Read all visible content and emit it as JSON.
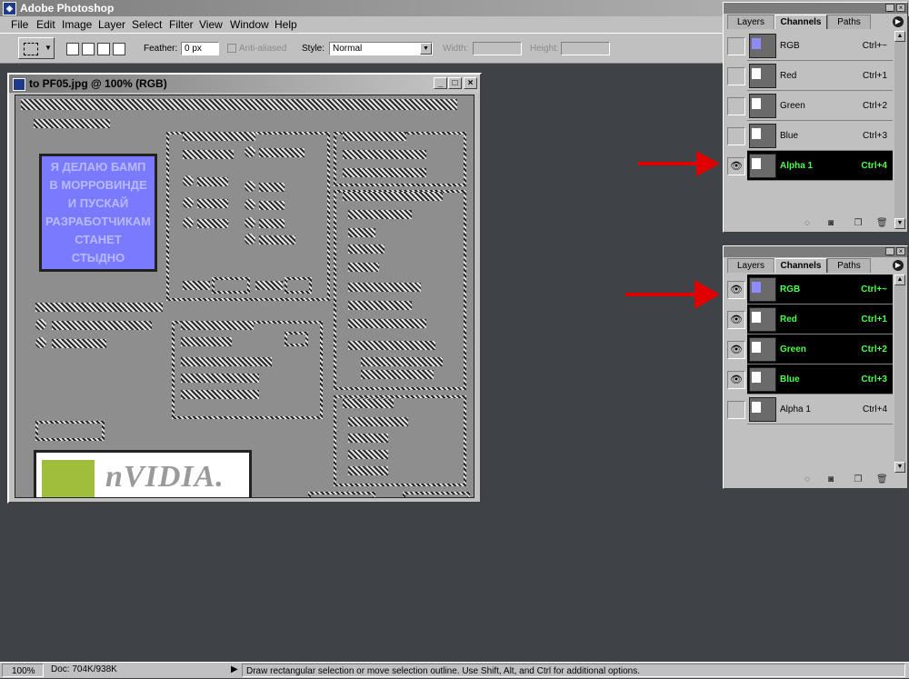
{
  "app": {
    "title": "Adobe Photoshop"
  },
  "menu": [
    "File",
    "Edit",
    "Image",
    "Layer",
    "Select",
    "Filter",
    "View",
    "Window",
    "Help"
  ],
  "options": {
    "feather_label": "Feather:",
    "feather_value": "0 px",
    "antialiased_label": "Anti-aliased",
    "style_label": "Style:",
    "style_value": "Normal",
    "width_label": "Width:",
    "height_label": "Height:"
  },
  "document": {
    "title": "to PF05.jpg @ 100% (RGB)",
    "preview_text": [
      "Я ДЕЛАЮ БАМП",
      "В МОРРОВИНДЕ",
      "И ПУСКАЙ",
      "РАЗРАБОТЧИКАМ",
      "СТАНЕТ",
      "СТЫДНО"
    ],
    "logo_text": "nVIDIA."
  },
  "panel_top": {
    "tabs": [
      "Layers",
      "Channels",
      "Paths"
    ],
    "active_tab": "Channels",
    "channels": [
      {
        "name": "RGB",
        "key": "Ctrl+~",
        "visible": false,
        "selected": false
      },
      {
        "name": "Red",
        "key": "Ctrl+1",
        "visible": false,
        "selected": false
      },
      {
        "name": "Green",
        "key": "Ctrl+2",
        "visible": false,
        "selected": false
      },
      {
        "name": "Blue",
        "key": "Ctrl+3",
        "visible": false,
        "selected": false
      },
      {
        "name": "Alpha 1",
        "key": "Ctrl+4",
        "visible": true,
        "selected": true
      }
    ]
  },
  "panel_bottom": {
    "tabs": [
      "Layers",
      "Channels",
      "Paths"
    ],
    "active_tab": "Channels",
    "channels": [
      {
        "name": "RGB",
        "key": "Ctrl+~",
        "visible": true,
        "selected": true
      },
      {
        "name": "Red",
        "key": "Ctrl+1",
        "visible": true,
        "selected": true
      },
      {
        "name": "Green",
        "key": "Ctrl+2",
        "visible": true,
        "selected": true
      },
      {
        "name": "Blue",
        "key": "Ctrl+3",
        "visible": true,
        "selected": true
      },
      {
        "name": "Alpha 1",
        "key": "Ctrl+4",
        "visible": false,
        "selected": false
      }
    ]
  },
  "status": {
    "zoom": "100%",
    "doc": "Doc: 704K/938K",
    "hint": "Draw rectangular selection or move selection outline.  Use Shift, Alt, and Ctrl for additional options."
  },
  "colors": {
    "selected_text": "#4cff4c",
    "arrow": "#e00000",
    "workspace": "#3f4247"
  }
}
